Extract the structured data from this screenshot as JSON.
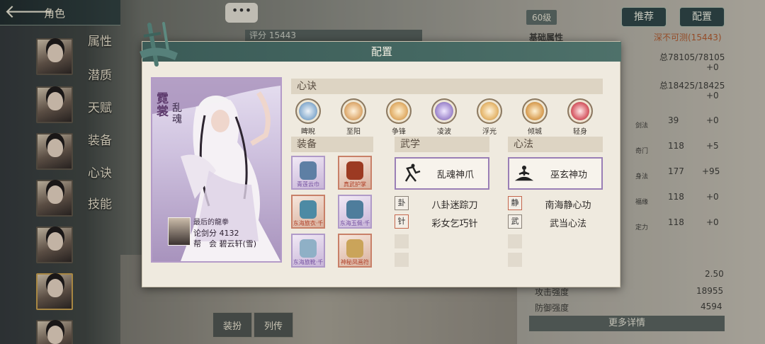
{
  "header": {
    "title": "角色",
    "back_glyph": "🡐",
    "chat_glyph": "•••"
  },
  "sidebar": {
    "tabs": [
      "属性",
      "潜质",
      "天赋",
      "装备",
      "心诀",
      "技能"
    ]
  },
  "background": {
    "score_label": "评分 15443",
    "level": "60级",
    "recommend_button": "推荐",
    "config_button": "配置",
    "base_attr_title": "基础属性",
    "difficulty": "深不可测(15443)",
    "hp": "总78105/78105",
    "hp_plus": "+0",
    "mp": "总18425/18425",
    "mp_plus": "+0",
    "stats": [
      {
        "label": "剑法",
        "value": "39",
        "plus": "+0"
      },
      {
        "label": "奇门",
        "value": "118",
        "plus": "+5"
      },
      {
        "label": "身法",
        "value": "177",
        "plus": "+95"
      },
      {
        "label": "福缘",
        "value": "118",
        "plus": "+0"
      },
      {
        "label": "定力",
        "value": "118",
        "plus": "+0"
      }
    ],
    "crit_value": "2.50",
    "attack_label": "攻击强度",
    "attack_value": "18955",
    "defense_label": "防御强度",
    "defense_value": "4594",
    "more_details": "更多详情",
    "bottom_btn1": "装扮",
    "bottom_btn2": "列传"
  },
  "modal": {
    "title": "配置",
    "character": {
      "name": "霓裳",
      "subtitle": "乱魂",
      "player_name": "最后的龍拳",
      "score": "论剑分 4132",
      "guild": "帮　会 碧云轩(雪)"
    },
    "xinjue": {
      "title": "心诀",
      "skills": [
        {
          "name": "睥睨",
          "color": "#7fa6c8"
        },
        {
          "name": "至阳",
          "color": "#d6a56c"
        },
        {
          "name": "争锋",
          "color": "#d9a760"
        },
        {
          "name": "凌波",
          "color": "#9b86c8"
        },
        {
          "name": "浮光",
          "color": "#e1b46a"
        },
        {
          "name": "倾城",
          "color": "#d4a055"
        },
        {
          "name": "轻身",
          "color": "#d0555a"
        }
      ]
    },
    "equipment": {
      "title": "装备",
      "items": [
        {
          "label": "青莲云巾",
          "rarity": "purple"
        },
        {
          "label": "真武护掌",
          "rarity": "red"
        },
        {
          "label": "东海旅衣·千",
          "rarity": "red"
        },
        {
          "label": "东海玉佩·千",
          "rarity": "purple"
        },
        {
          "label": "东海旅靴·千",
          "rarity": "purple"
        },
        {
          "label": "神秘凤画符",
          "rarity": "red"
        }
      ]
    },
    "wuxue": {
      "title": "武学",
      "main": "乱魂神爪",
      "subs": [
        "八卦迷踪刀",
        "彩女乞巧针"
      ]
    },
    "xinfa": {
      "title": "心法",
      "main": "巫玄神功",
      "subs": [
        "南海静心功",
        "武当心法"
      ]
    }
  },
  "colors": {
    "header_teal": "#456862",
    "card_purple": "#b49bc8",
    "section_bg": "#ddd4c3",
    "modal_bg": "#efeadf"
  }
}
